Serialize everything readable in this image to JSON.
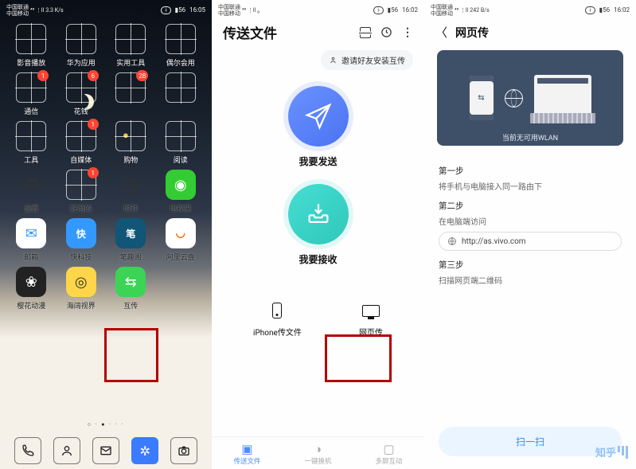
{
  "status": {
    "carrier1": "中国联通",
    "carrier2": "中国移动",
    "sig": "⁴⁶ ⋮ll",
    "speed": "3.3 K/s",
    "speed_p3": "242 B/s",
    "bt": "⋮",
    "batt": "56",
    "time_p1": "16:05",
    "time_p23": "16:02"
  },
  "p1": {
    "apps": [
      [
        {
          "l": "影音播放",
          "b": null
        },
        {
          "l": "华为应用",
          "b": null
        },
        {
          "l": "实用工具",
          "b": null
        },
        {
          "l": "偶尔会用",
          "b": null
        }
      ],
      [
        {
          "l": "通信",
          "b": "1"
        },
        {
          "l": "花钱",
          "b": "6"
        },
        {
          "l": "",
          "b": "28"
        },
        {
          "l": "",
          "b": null
        }
      ],
      [
        {
          "l": "工具",
          "b": null
        },
        {
          "l": "自媒体",
          "b": "1"
        },
        {
          "l": "购物",
          "b": null
        },
        {
          "l": "阅读",
          "b": null
        }
      ],
      [
        {
          "l": "设置",
          "b": null,
          "i": "gear"
        },
        {
          "l": "好用的",
          "b": "1"
        },
        {
          "l": "时钟",
          "b": null,
          "i": "clock"
        },
        {
          "l": "电视果",
          "b": null,
          "i": "tv"
        }
      ],
      [
        {
          "l": "邮箱",
          "b": null,
          "i": "mail"
        },
        {
          "l": "快科技",
          "b": null,
          "i": "kk"
        },
        {
          "l": "笔趣阁",
          "b": null,
          "i": "bq"
        },
        {
          "l": "阿里云盘",
          "b": null,
          "i": "ali"
        }
      ],
      [
        {
          "l": "樱花动漫",
          "b": null,
          "i": "sakura"
        },
        {
          "l": "海阔视界",
          "b": null,
          "i": "hk"
        },
        {
          "l": "互传",
          "b": null,
          "i": "hc"
        },
        {
          "l": "",
          "b": null,
          "skip": true
        }
      ]
    ],
    "highlight": "互传"
  },
  "p2": {
    "title": "传送文件",
    "invite": "邀请好友安装互传",
    "send": "我要发送",
    "recv": "我要接收",
    "iphone": "iPhone传文件",
    "web": "网页传",
    "tabs": [
      {
        "l": "传送文件",
        "a": true
      },
      {
        "l": "一键换机",
        "a": false
      },
      {
        "l": "多屏互动",
        "a": false
      }
    ]
  },
  "p3": {
    "title": "网页传",
    "caption": "当前无可用WLAN",
    "s1": "第一步",
    "s1d": "将手机与电脑接入同一路由下",
    "s2": "第二步",
    "s2d": "在电脑端访问",
    "url": "http://as.vivo.com",
    "s3": "第三步",
    "s3d": "扫描网页端二维码",
    "scan": "扫一扫"
  },
  "watermark": "知乎"
}
